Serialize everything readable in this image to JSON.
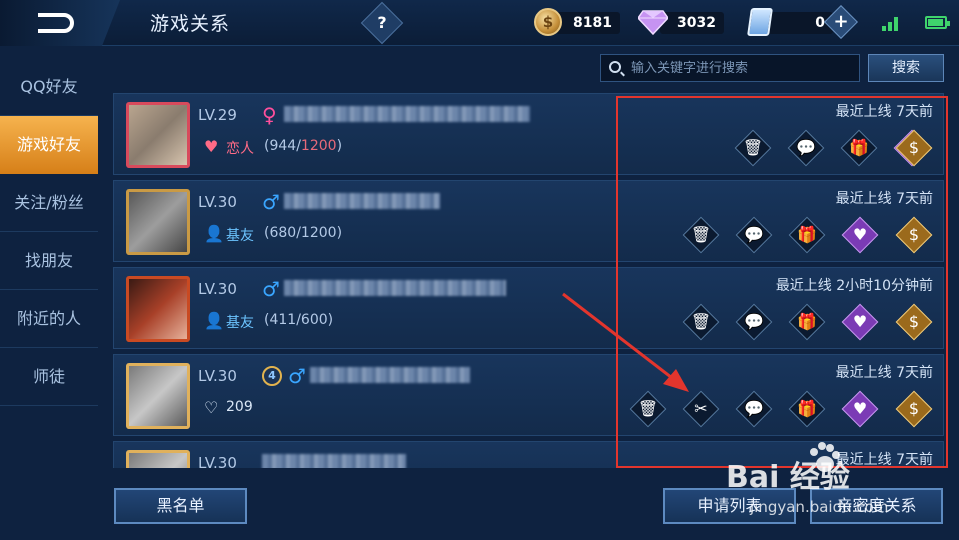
{
  "header": {
    "title": "游戏关系",
    "help_label": "?",
    "gold": "8181",
    "diamonds": "3032",
    "vouchers": "0",
    "plus_label": "+"
  },
  "sidebar": {
    "items": [
      {
        "label": "QQ好友"
      },
      {
        "label": "游戏好友"
      },
      {
        "label": "关注/粉丝"
      },
      {
        "label": "找朋友"
      },
      {
        "label": "附近的人"
      },
      {
        "label": "师徒"
      }
    ],
    "active_index": 1
  },
  "search": {
    "placeholder": "输入关键字进行搜索",
    "button_label": "搜索"
  },
  "friends": [
    {
      "level": "LV.29",
      "gender": "female",
      "gender_symbol": "♀",
      "relation_icon": "heart-icon",
      "relation": "恋人",
      "intimacy": "944",
      "intimacy_max": "1200",
      "last_online_label": "最近上线",
      "last_online": "7天前"
    },
    {
      "level": "LV.30",
      "gender": "male",
      "gender_symbol": "♂",
      "relation_icon": "buddy-icon",
      "relation": "基友",
      "intimacy": "680",
      "intimacy_max": "1200",
      "last_online_label": "最近上线",
      "last_online": "7天前"
    },
    {
      "level": "LV.30",
      "gender": "male",
      "gender_symbol": "♂",
      "relation_icon": "buddy-icon",
      "relation": "基友",
      "intimacy": "411",
      "intimacy_max": "600",
      "last_online_label": "最近上线",
      "last_online": "2小时10分钟前"
    },
    {
      "level": "LV.30",
      "gender": "male",
      "gender_symbol": "♂",
      "rank_badge": "4",
      "relation_icon": "broken-heart-icon",
      "intimacy_plain": "209",
      "last_online_label": "最近上线",
      "last_online": "7天前"
    },
    {
      "level": "LV.30",
      "last_online_label": "最近上线",
      "last_online": "7天前"
    }
  ],
  "bottom": {
    "blacklist_label": "黑名单",
    "requests_label": "申请列表",
    "intimate_label": "亲密度关系"
  },
  "watermark": {
    "brand": "Bai 经验",
    "url": "jingyan.baidu.com"
  },
  "colors": {
    "accent": "#e8a33a",
    "highlight": "#e3352d",
    "female": "#ff4f9c",
    "male": "#3aa6ff"
  }
}
